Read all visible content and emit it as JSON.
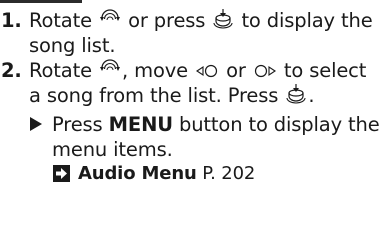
{
  "steps": [
    {
      "number": "1.",
      "text_part1": "Rotate",
      "text_part2": "or press",
      "text_part3": "to display the song list."
    },
    {
      "number": "2.",
      "text_part1": "Rotate",
      "text_part2": ", move",
      "text_part3": "or",
      "text_part4": "to select a song from the list. Press",
      "text_part5": "."
    }
  ],
  "note": {
    "prefix": "Press",
    "bold": "MENU",
    "suffix": "button to display the menu items."
  },
  "reference": {
    "title": "Audio Menu",
    "page": "P. 202"
  },
  "icons": {
    "rotate": "rotate-knob-icon",
    "press": "press-knob-icon",
    "move_left": "move-left-icon",
    "move_right": "move-right-icon",
    "bullet": "triangle-bullet-icon",
    "ref": "reference-arrow-icon"
  },
  "colors": {
    "text": "#1a1a1a",
    "header_bar": "#2b2b2b"
  }
}
